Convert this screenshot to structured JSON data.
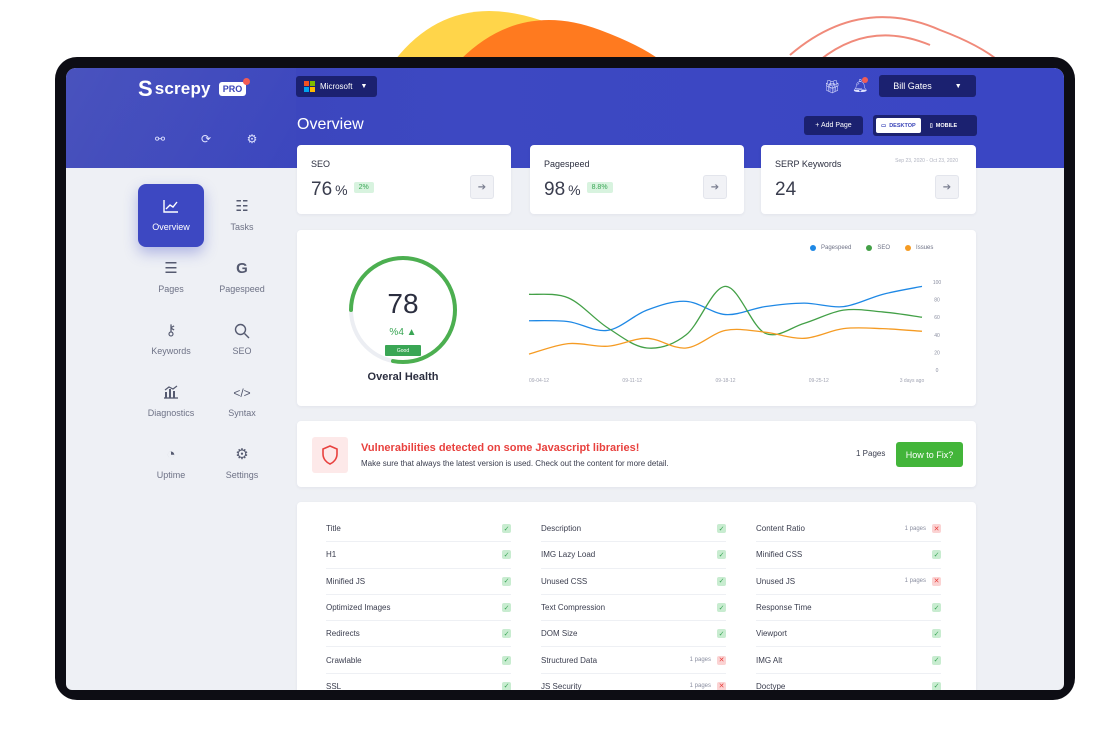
{
  "brand": {
    "logo_mark": "S",
    "name": "screpy",
    "plan_badge": "PRO"
  },
  "colors": {
    "primary": "#3d48c2",
    "header_dark": "#1b2170",
    "success": "#3aa655",
    "danger": "#e8413e",
    "pagespeed": "#1e88e5",
    "seo": "#43a047",
    "issues": "#f59b23"
  },
  "toolbar_icons": [
    "flow-icon",
    "refresh-icon",
    "settings-icon"
  ],
  "header": {
    "workspace": "Microsoft",
    "user": "Bill Gates",
    "title": "Overview",
    "add_page": "+ Add Page",
    "device": {
      "desktop": "DESKTOP",
      "mobile": "MOBILE",
      "selected": "DESKTOP"
    }
  },
  "nav": [
    {
      "label": "Overview",
      "icon": "chart-icon",
      "glyph": "📈"
    },
    {
      "label": "Tasks",
      "icon": "tasks-icon",
      "glyph": "☷"
    },
    {
      "label": "Pages",
      "icon": "list-icon",
      "glyph": "☰"
    },
    {
      "label": "Pagespeed",
      "icon": "google-icon",
      "glyph": "G"
    },
    {
      "label": "Keywords",
      "icon": "key-icon",
      "glyph": "⚷"
    },
    {
      "label": "SEO",
      "icon": "search-icon",
      "glyph": "⌕"
    },
    {
      "label": "Diagnostics",
      "icon": "diagnostics-icon",
      "glyph": "📊"
    },
    {
      "label": "Syntax",
      "icon": "code-icon",
      "glyph": "</>"
    },
    {
      "label": "Uptime",
      "icon": "speedometer-icon",
      "glyph": "◔"
    },
    {
      "label": "Settings",
      "icon": "gear-icon",
      "glyph": "⚙"
    }
  ],
  "kpis": {
    "seo": {
      "label": "SEO",
      "value": "76",
      "unit": "%",
      "delta": "2%"
    },
    "pagespeed": {
      "label": "Pagespeed",
      "value": "98",
      "unit": "%",
      "delta": "8.8%"
    },
    "serp": {
      "label": "SERP Keywords",
      "value": "24",
      "date_range": "Sep 23, 2020 - Oct 23, 2020"
    }
  },
  "health": {
    "score": "78",
    "delta": "%4 ▲",
    "status": "Good",
    "score_fraction": 0.78,
    "label": "Overal Health"
  },
  "chart_data": {
    "type": "line",
    "x": [
      "09-04-12",
      "09-11-12",
      "09-18-12",
      "09-25-12",
      "3 days ago"
    ],
    "ylim": [
      0,
      100
    ],
    "yticks": [
      0,
      20,
      40,
      60,
      80,
      100
    ],
    "legend": "top-right",
    "series": [
      {
        "name": "Pagespeed",
        "color": "#1e88e5",
        "values": [
          56,
          55,
          45,
          68,
          78,
          63,
          72,
          76,
          72,
          86,
          95
        ]
      },
      {
        "name": "SEO",
        "color": "#43a047",
        "values": [
          86,
          82,
          48,
          25,
          40,
          95,
          42,
          53,
          68,
          66,
          60
        ]
      },
      {
        "name": "Issues",
        "color": "#f59b23",
        "values": [
          18,
          30,
          27,
          36,
          25,
          45,
          43,
          36,
          47,
          47,
          44
        ]
      }
    ]
  },
  "alert": {
    "title": "Vulnerabilities detected on some Javascript libraries!",
    "description": "Make sure that always the latest version is used. Check out the content for more detail.",
    "count": "1 Pages",
    "button": "How to Fix?"
  },
  "checks": [
    [
      {
        "label": "Title",
        "ok": true,
        "pages": ""
      },
      {
        "label": "H1",
        "ok": true,
        "pages": ""
      },
      {
        "label": "Minified JS",
        "ok": true,
        "pages": ""
      },
      {
        "label": "Optimized Images",
        "ok": true,
        "pages": ""
      },
      {
        "label": "Redirects",
        "ok": true,
        "pages": ""
      },
      {
        "label": "Crawlable",
        "ok": true,
        "pages": ""
      },
      {
        "label": "SSL",
        "ok": true,
        "pages": ""
      }
    ],
    [
      {
        "label": "Description",
        "ok": true,
        "pages": ""
      },
      {
        "label": "IMG Lazy Load",
        "ok": true,
        "pages": ""
      },
      {
        "label": "Unused CSS",
        "ok": true,
        "pages": ""
      },
      {
        "label": "Text Compression",
        "ok": true,
        "pages": ""
      },
      {
        "label": "DOM Size",
        "ok": true,
        "pages": ""
      },
      {
        "label": "Structured Data",
        "ok": false,
        "pages": "1 pages"
      },
      {
        "label": "JS Security",
        "ok": false,
        "pages": "1 pages"
      }
    ],
    [
      {
        "label": "Content Ratio",
        "ok": false,
        "pages": "1 pages"
      },
      {
        "label": "Minified CSS",
        "ok": true,
        "pages": ""
      },
      {
        "label": "Unused JS",
        "ok": false,
        "pages": "1 pages"
      },
      {
        "label": "Response Time",
        "ok": true,
        "pages": ""
      },
      {
        "label": "Viewport",
        "ok": true,
        "pages": ""
      },
      {
        "label": "IMG Alt",
        "ok": true,
        "pages": ""
      },
      {
        "label": "Doctype",
        "ok": true,
        "pages": ""
      }
    ]
  ]
}
